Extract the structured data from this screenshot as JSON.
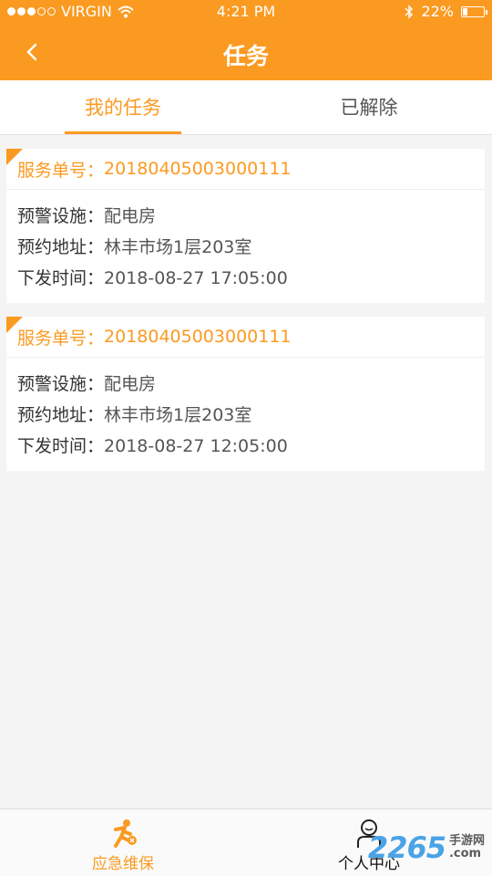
{
  "status_bar": {
    "carrier": "VIRGIN",
    "time": "4:21 PM",
    "battery": "22%",
    "battery_level": 0.22
  },
  "nav": {
    "title": "任务"
  },
  "tabs": [
    {
      "label": "我的任务",
      "active": true
    },
    {
      "label": "已解除",
      "active": false
    }
  ],
  "cards": [
    {
      "order_label": "服务单号：",
      "order_no": "20180405003000111",
      "facility_label": "预警设施：",
      "facility": "配电房",
      "address_label": "预约地址：",
      "address": "林丰市场1层203室",
      "time_label": "下发时间：",
      "time": "2018-08-27 17:05:00"
    },
    {
      "order_label": "服务单号：",
      "order_no": "20180405003000111",
      "facility_label": "预警设施：",
      "facility": "配电房",
      "address_label": "预约地址：",
      "address": "林丰市场1层203室",
      "time_label": "下发时间：",
      "time": "2018-08-27 12:05:00"
    }
  ],
  "tabbar": [
    {
      "label": "应急维保",
      "icon": "running-person-icon",
      "active": true
    },
    {
      "label": "个人中心",
      "icon": "person-icon",
      "active": false
    }
  ],
  "watermark": {
    "number": "2265",
    "text1": "手游网",
    "text2": ".com"
  },
  "colors": {
    "accent": "#fb9a21",
    "background": "#f4f4f4"
  }
}
